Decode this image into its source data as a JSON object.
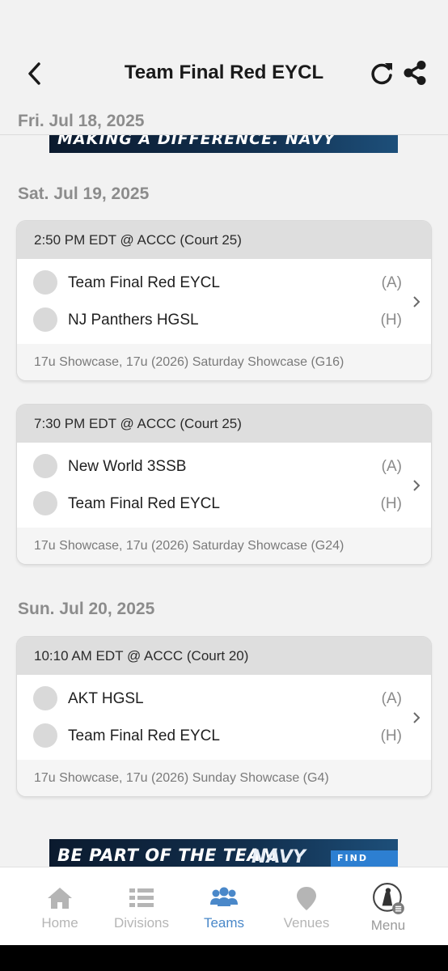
{
  "header": {
    "title": "Team Final Red EYCL",
    "back_icon": "chevron-left-icon",
    "refresh_icon": "refresh-icon",
    "share_icon": "share-icon"
  },
  "sticky_date": "Fri. Jul 18, 2025",
  "ads": {
    "top_text": "MAKING A DIFFERENCE.  NAVY",
    "bottom_text": "BE PART OF THE TEAM",
    "bottom_brand": "NAVY",
    "bottom_button": "FIND",
    "ad_choice": "▷"
  },
  "days": [
    {
      "date": "Sat. Jul 19, 2025",
      "matches": [
        {
          "header": "2:50 PM EDT @ ACCC (Court 25)",
          "teams": [
            {
              "name": "Team Final Red EYCL",
              "side": "(A)"
            },
            {
              "name": "NJ Panthers HGSL",
              "side": "(H)"
            }
          ],
          "footer": "17u Showcase, 17u (2026) Saturday Showcase (G16)"
        },
        {
          "header": "7:30 PM EDT @ ACCC (Court 25)",
          "teams": [
            {
              "name": "New World 3SSB",
              "side": "(A)"
            },
            {
              "name": "Team Final Red EYCL",
              "side": "(H)"
            }
          ],
          "footer": "17u Showcase, 17u (2026) Saturday Showcase (G24)"
        }
      ]
    },
    {
      "date": "Sun. Jul 20, 2025",
      "matches": [
        {
          "header": "10:10 AM EDT @ ACCC (Court 20)",
          "teams": [
            {
              "name": "AKT HGSL",
              "side": "(A)"
            },
            {
              "name": "Team Final Red EYCL",
              "side": "(H)"
            }
          ],
          "footer": "17u Showcase, 17u (2026) Sunday Showcase (G4)"
        }
      ]
    }
  ],
  "tabbar": {
    "items": [
      {
        "label": "Home",
        "icon": "home-icon"
      },
      {
        "label": "Divisions",
        "icon": "list-icon"
      },
      {
        "label": "Teams",
        "icon": "people-icon",
        "active": true
      },
      {
        "label": "Venues",
        "icon": "map-pin-icon"
      },
      {
        "label": "Menu",
        "icon": "menu-avatar-icon"
      }
    ]
  },
  "colors": {
    "accent": "#4a88c9",
    "background": "#f2f2f2",
    "card_header": "#dedede",
    "muted_text": "#8c8c8c"
  }
}
